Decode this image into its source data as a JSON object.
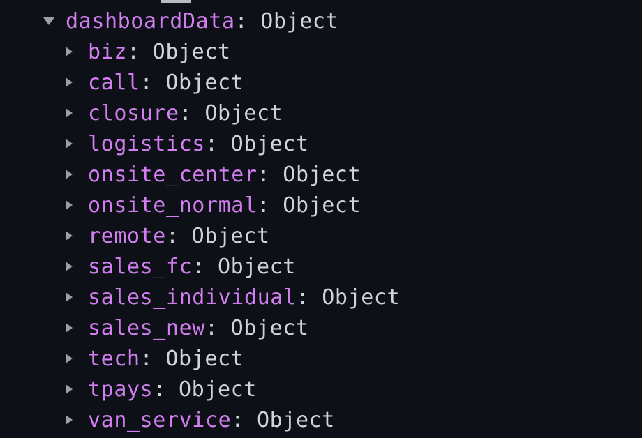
{
  "tree": {
    "root": {
      "key": "dashboardData",
      "value": "Object"
    },
    "children": [
      {
        "key": "biz",
        "value": "Object"
      },
      {
        "key": "call",
        "value": "Object"
      },
      {
        "key": "closure",
        "value": "Object"
      },
      {
        "key": "logistics",
        "value": "Object"
      },
      {
        "key": "onsite_center",
        "value": "Object"
      },
      {
        "key": "onsite_normal",
        "value": "Object"
      },
      {
        "key": "remote",
        "value": "Object"
      },
      {
        "key": "sales_fc",
        "value": "Object"
      },
      {
        "key": "sales_individual",
        "value": "Object"
      },
      {
        "key": "sales_new",
        "value": "Object"
      },
      {
        "key": "tech",
        "value": "Object"
      },
      {
        "key": "tpays",
        "value": "Object"
      },
      {
        "key": "van_service",
        "value": "Object"
      }
    ]
  },
  "icons": {
    "expanded": "caret-down-icon",
    "collapsed": "caret-right-icon"
  },
  "colors": {
    "background": "#0d1117",
    "key": "#d27ef0",
    "value": "#cfd3da",
    "arrow": "#9aa0a8"
  }
}
